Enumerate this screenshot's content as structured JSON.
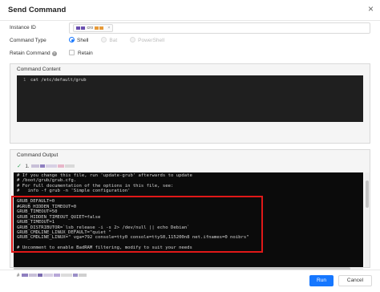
{
  "dialog": {
    "title": "Send Command",
    "close_symbol": "×"
  },
  "form": {
    "instance_label": "Instance ID",
    "instance_tag_text": "cro",
    "instance_tag_remove": "×",
    "command_type_label": "Command Type",
    "command_type_options": [
      {
        "label": "Shell",
        "selected": true,
        "disabled": false
      },
      {
        "label": "Bat",
        "selected": false,
        "disabled": true
      },
      {
        "label": "PowerShell",
        "selected": false,
        "disabled": true
      }
    ],
    "retain_label": "Retain Command",
    "retain_help_symbol": "?",
    "retain_checkbox_label": "Retain",
    "retain_checked": false
  },
  "command_content": {
    "title": "Command Content",
    "line_number": "1",
    "code": "cat /etc/default/grub"
  },
  "command_output": {
    "title": "Command Output",
    "status_icon": "✓",
    "instance_prefix": "1.",
    "lines": [
      "# If you change this file, run 'update-grub' afterwards to update",
      "# /boot/grub/grub.cfg.",
      "# For full documentation of the options in this file, see:",
      "#   info -f grub -n 'Simple configuration'",
      "",
      "GRUB_DEFAULT=0",
      "#GRUB_HIDDEN_TIMEOUT=0",
      "GRUB_TIMEOUT=50",
      "GRUB_HIDDEN_TIMEOUT_QUIET=false",
      "GRUB_TIMEOUT=1",
      "GRUB_DISTRIBUTOR=`lsb_release -i -s 2> /dev/null || echo Debian`",
      "GRUB_CMDLINE_LINUX_DEFAULT=\"quiet \"",
      "GRUB_CMDLINE_LINUX=\" vga=792 console=tty0 console=ttyS0,115200n8 net.ifnames=0 noibrs\"",
      "",
      "# Uncomment to enable BadRAM filtering, modify to suit your needs"
    ],
    "bottom_prefix": "#"
  },
  "footer": {
    "run_label": "Run",
    "cancel_label": "Cancel"
  },
  "colors": {
    "primary": "#1677ff",
    "highlight_border": "#e01818",
    "terminal_bg": "#0b0b0b",
    "editor_bg": "#1f1f1f",
    "success": "#3ba55c"
  }
}
